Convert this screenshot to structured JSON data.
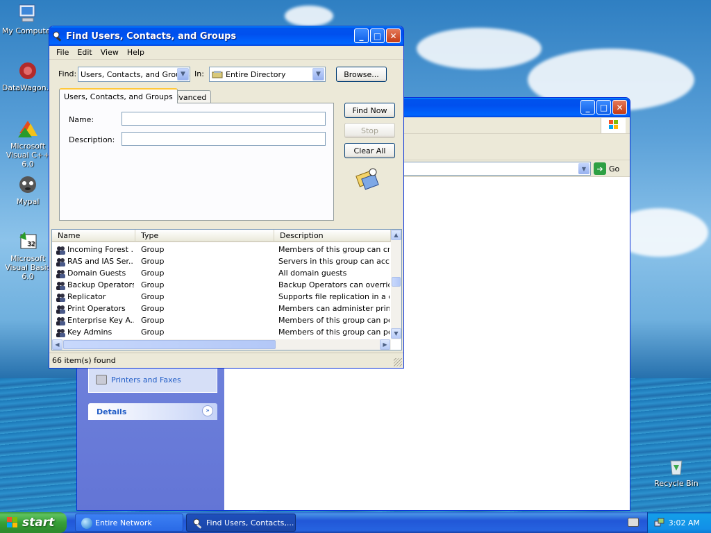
{
  "desktop": {
    "icons": [
      {
        "label": "My Computer"
      },
      {
        "label": "DataWagon..."
      },
      {
        "label": "Microsoft Visual C++ 6.0"
      },
      {
        "label": "Mypal"
      },
      {
        "label": "Microsoft Visual Basic 6.0"
      },
      {
        "label": "Recycle Bin"
      }
    ]
  },
  "bg_window": {
    "go_label": "Go",
    "sidebar_link": "Printers and Faxes",
    "details_label": "Details"
  },
  "find_dialog": {
    "title": "Find Users, Contacts, and Groups",
    "menu": [
      "File",
      "Edit",
      "View",
      "Help"
    ],
    "find_label": "Find:",
    "find_value": "Users, Contacts, and Groups",
    "in_label": "In:",
    "in_value": "Entire Directory",
    "browse_label": "Browse...",
    "tabs": [
      "Users, Contacts, and Groups",
      "Advanced"
    ],
    "name_label": "Name:",
    "description_label": "Description:",
    "find_now_label": "Find Now",
    "stop_label": "Stop",
    "clear_all_label": "Clear All",
    "columns": [
      "Name",
      "Type",
      "Description"
    ],
    "rows": [
      {
        "name": "Incoming Forest ...",
        "type": "Group",
        "description": "Members of this group can create"
      },
      {
        "name": "RAS and IAS Ser...",
        "type": "Group",
        "description": "Servers in this group can access r"
      },
      {
        "name": "Domain Guests",
        "type": "Group",
        "description": "All domain guests"
      },
      {
        "name": "Backup Operators",
        "type": "Group",
        "description": "Backup Operators can override se"
      },
      {
        "name": "Replicator",
        "type": "Group",
        "description": "Supports file replication in a doma"
      },
      {
        "name": "Print Operators",
        "type": "Group",
        "description": "Members can administer printers i"
      },
      {
        "name": "Enterprise Key A...",
        "type": "Group",
        "description": "Members of this group can perfor"
      },
      {
        "name": "Key Admins",
        "type": "Group",
        "description": "Members of this group can perfor"
      }
    ],
    "status": "66 item(s) found"
  },
  "taskbar": {
    "start_label": "start",
    "items": [
      "Entire Network",
      "Find Users, Contacts,..."
    ],
    "clock": "3:02 AM"
  },
  "colors": {
    "title_blue": "#0053ee",
    "start_green": "#37a037",
    "sidebar_blue": "#6375d6"
  }
}
